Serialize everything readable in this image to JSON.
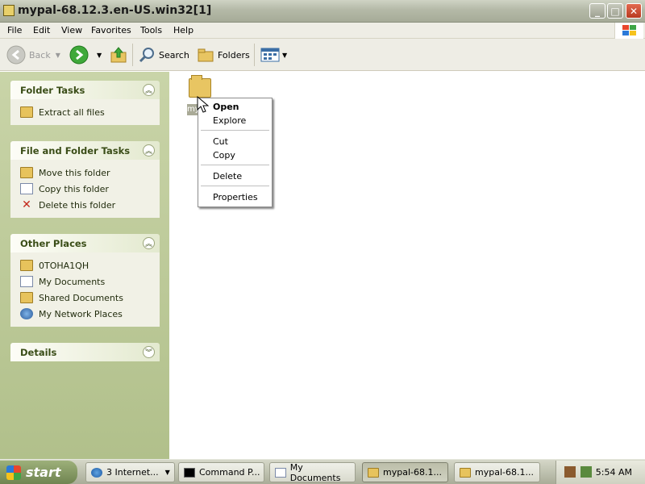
{
  "window": {
    "title": "mypal-68.12.3.en-US.win32[1]"
  },
  "menu": [
    "File",
    "Edit",
    "View",
    "Favorites",
    "Tools",
    "Help"
  ],
  "toolbar": {
    "back": "Back",
    "search": "Search",
    "folders": "Folders"
  },
  "sidebar": {
    "folder_tasks": {
      "title": "Folder Tasks",
      "items": [
        "Extract all files"
      ]
    },
    "file_folder_tasks": {
      "title": "File and Folder Tasks",
      "items": [
        "Move this folder",
        "Copy this folder",
        "Delete this folder"
      ]
    },
    "other_places": {
      "title": "Other Places",
      "items": [
        "0TOHA1QH",
        "My Documents",
        "Shared Documents",
        "My Network Places"
      ]
    },
    "details": {
      "title": "Details"
    }
  },
  "content": {
    "selected_label": "my"
  },
  "context_menu": {
    "items": [
      "Open",
      "Explore",
      "Cut",
      "Copy",
      "Delete",
      "Properties"
    ]
  },
  "taskbar": {
    "start": "start",
    "buttons": [
      "3 Internet...",
      "Command P...",
      "My Documents",
      "mypal-68.1...",
      "mypal-68.1..."
    ],
    "clock": "5:54 AM"
  }
}
